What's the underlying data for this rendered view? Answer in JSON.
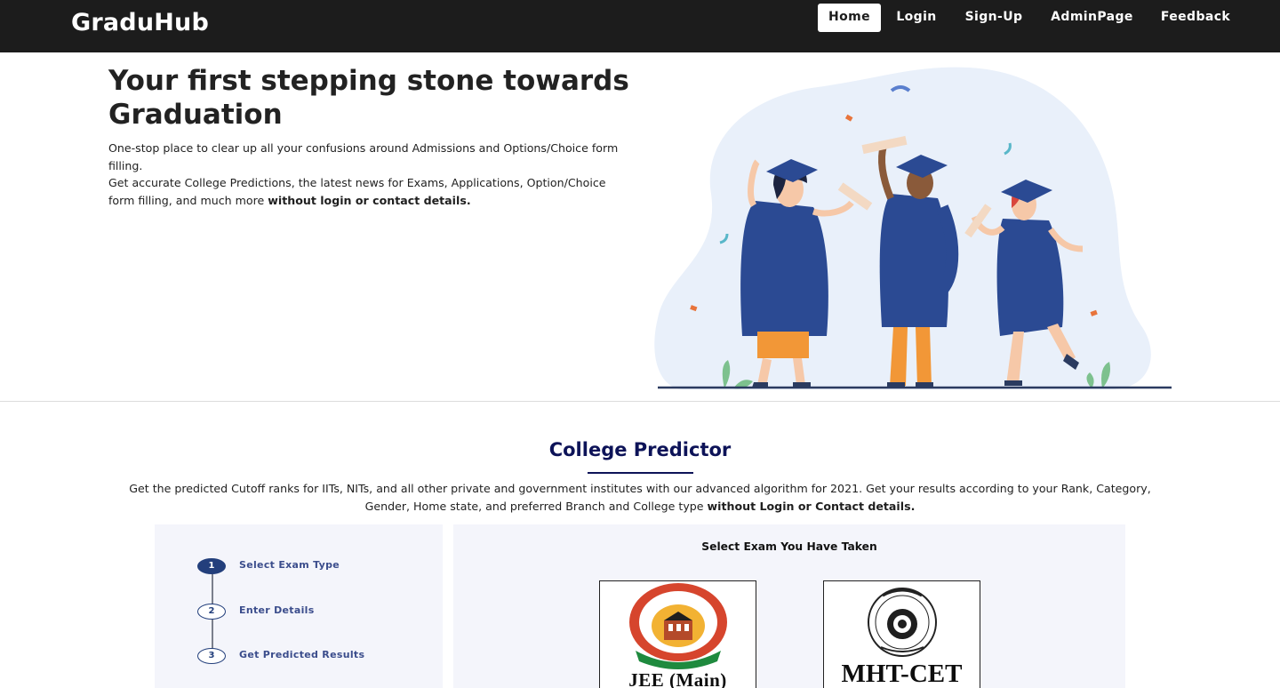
{
  "navbar": {
    "brand": "GraduHub",
    "links": [
      {
        "label": "Home",
        "active": true
      },
      {
        "label": "Login",
        "active": false
      },
      {
        "label": "Sign-Up",
        "active": false
      },
      {
        "label": "AdminPage",
        "active": false
      },
      {
        "label": "Feedback",
        "active": false
      }
    ]
  },
  "hero": {
    "title": "Your first stepping stone towards Graduation",
    "line1": "One-stop place to clear up all your confusions around Admissions and Options/Choice form filling.",
    "line2": "Get accurate College Predictions, the latest news for Exams, Applications, Option/Choice form filling, and much more",
    "line2_bold": "without login or contact details."
  },
  "predictor": {
    "title": "College Predictor",
    "description": "Get the predicted Cutoff ranks for IITs, NITs, and all other private and government institutes with our advanced algorithm for 2021. Get your results according to your Rank, Category, Gender, Home state, and preferred Branch and College type",
    "description_bold": "without Login or Contact details.",
    "steps": [
      {
        "number": "1",
        "label": "Select Exam Type",
        "active": true
      },
      {
        "number": "2",
        "label": "Enter Details",
        "active": false
      },
      {
        "number": "3",
        "label": "Get Predicted Results",
        "active": false
      }
    ],
    "exam_panel_title": "Select Exam You Have Taken",
    "exams": [
      {
        "name": "JEE (Main)"
      },
      {
        "name": "MHT-CET"
      }
    ]
  },
  "colors": {
    "navbar_bg": "#1c1c1c",
    "title_navy": "#0d1358",
    "gown_blue": "#2b4a93",
    "panel_bg": "#f4f5fb"
  }
}
